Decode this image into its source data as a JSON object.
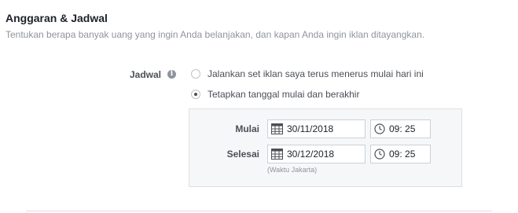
{
  "section": {
    "title": "Anggaran & Jadwal",
    "subtitle": "Tentukan berapa banyak uang yang ingin Anda belanjakan, dan kapan Anda ingin iklan ditayangkan."
  },
  "schedule": {
    "label": "Jadwal",
    "info_icon": "i",
    "options": [
      {
        "label": "Jalankan set iklan saya terus menerus mulai hari ini",
        "selected": false
      },
      {
        "label": "Tetapkan tanggal mulai dan berakhir",
        "selected": true
      }
    ],
    "start": {
      "label": "Mulai",
      "date": "30/11/2018",
      "time": "09: 25"
    },
    "end": {
      "label": "Selesai",
      "date": "30/12/2018",
      "time": "09: 25"
    },
    "timezone_note": "(Waktu Jakarta)"
  },
  "icons": {
    "calendar": "calendar-icon",
    "clock": "clock-icon",
    "info": "info-icon"
  },
  "colors": {
    "text_primary": "#1d2129",
    "text_secondary": "#90949c",
    "panel_bg": "#f6f7f9",
    "border": "#dddfe2"
  }
}
